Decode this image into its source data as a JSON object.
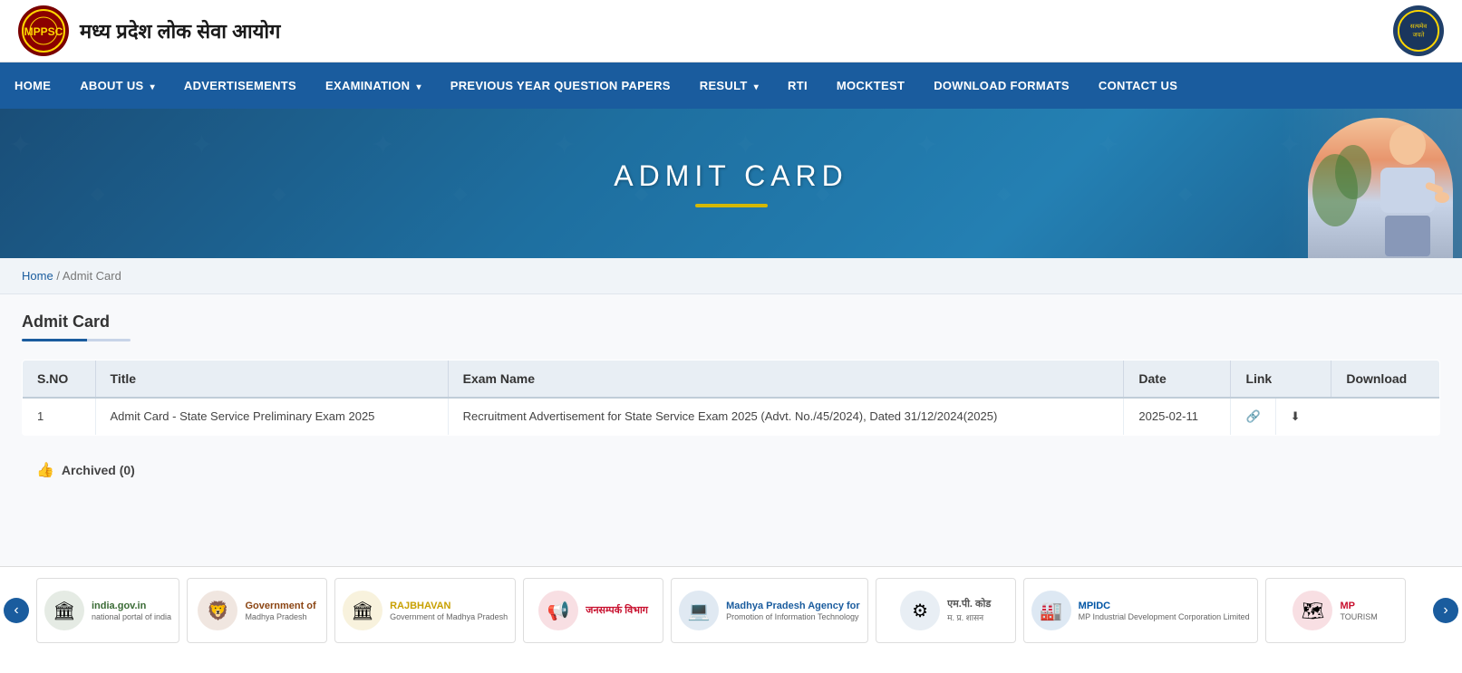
{
  "header": {
    "logo_text": "⊙",
    "site_title": "मध्य प्रदेश लोक सेवा आयोग",
    "right_logo_text": "सत्यमेव जयते"
  },
  "nav": {
    "items": [
      {
        "label": "HOME",
        "has_arrow": false
      },
      {
        "label": "ABOUT US",
        "has_arrow": true
      },
      {
        "label": "ADVERTISEMENTS",
        "has_arrow": false
      },
      {
        "label": "EXAMINATION",
        "has_arrow": true
      },
      {
        "label": "PREVIOUS YEAR QUESTION PAPERS",
        "has_arrow": false
      },
      {
        "label": "RESULT",
        "has_arrow": true
      },
      {
        "label": "RTI",
        "has_arrow": false
      },
      {
        "label": "MOCKTEST",
        "has_arrow": false
      },
      {
        "label": "DOWNLOAD FORMATS",
        "has_arrow": false
      },
      {
        "label": "CONTACT US",
        "has_arrow": false
      }
    ]
  },
  "banner": {
    "title": "ADMIT CARD"
  },
  "breadcrumb": {
    "home": "Home",
    "separator": "/",
    "current": "Admit Card"
  },
  "section": {
    "title": "Admit Card"
  },
  "table": {
    "columns": [
      "S.NO",
      "Title",
      "Exam Name",
      "Date",
      "Link",
      "Download"
    ],
    "rows": [
      {
        "sno": "1",
        "title": "Admit Card - State Service Preliminary Exam 2025",
        "exam_name": "Recruitment Advertisement for State Service Exam 2025 (Advt. No./45/2024), Dated 31/12/2024(2025)",
        "date": "2025-02-11",
        "link_icon": "🔗",
        "download_icon": "⬇"
      }
    ]
  },
  "archived": {
    "label": "Archived (0)",
    "icon": "👍"
  },
  "footer_logos": [
    {
      "icon": "🏛",
      "name": "india.gov.in",
      "sub": "national portal of india",
      "color": "#3a6b35"
    },
    {
      "icon": "🦁",
      "name": "Government of",
      "sub": "Madhya Pradesh",
      "color": "#8b4513"
    },
    {
      "icon": "🏛",
      "name": "RAJBHAVAN",
      "sub": "Government of Madhya Pradesh",
      "color": "#c8a000"
    },
    {
      "icon": "📢",
      "name": "जनसम्पर्क विभाग",
      "sub": "",
      "color": "#c8102e"
    },
    {
      "icon": "💻",
      "name": "Madhya Pradesh Agency for",
      "sub": "Promotion of Information Technology",
      "color": "#1a5c9e"
    },
    {
      "icon": "⚙",
      "name": "एम.पी. कोड",
      "sub": "म. प्र. शासन",
      "color": "#555"
    },
    {
      "icon": "🏭",
      "name": "MPIDC",
      "sub": "MP Industrial Development Corporation Limited",
      "color": "#0055a5"
    },
    {
      "icon": "🗺",
      "name": "MP",
      "sub": "TOURISM",
      "color": "#c8102e"
    }
  ],
  "scroll_left": "‹",
  "scroll_right": "›"
}
